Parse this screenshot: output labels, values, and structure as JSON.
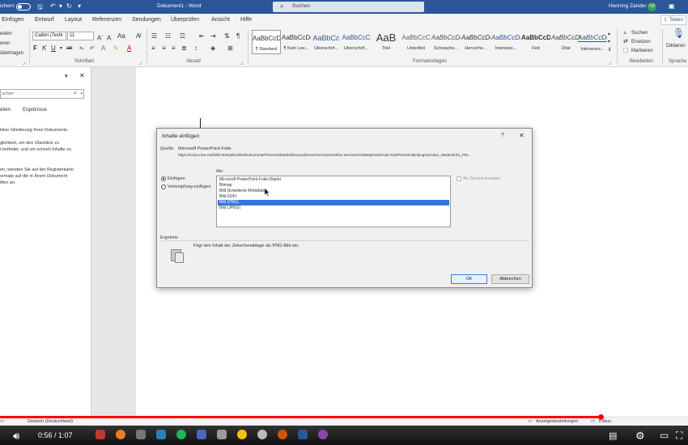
{
  "window": {
    "autosave_label": "ichern",
    "title": "Dokument1 - Word",
    "search_placeholder": "Suchen",
    "user": "Henning Zander",
    "avatar_initials": "HZ"
  },
  "menu": {
    "tabs": [
      "Einfügen",
      "Entwurf",
      "Layout",
      "Referenzen",
      "Sendungen",
      "Überprüfen",
      "Ansicht",
      "Hilfe"
    ],
    "share_label": "Teilen"
  },
  "ribbon": {
    "clipboard": {
      "partial1": "eiden",
      "partial2": "eren",
      "format_painter": "übertragen"
    },
    "font": {
      "family": "Calibri (Textk",
      "size": "11",
      "label": "Schriftart",
      "buttons": [
        "F",
        "K",
        "U",
        "ab",
        "x₂",
        "x²"
      ]
    },
    "paragraph": {
      "label": "Absatz"
    },
    "styles": {
      "label": "Formatvorlagen",
      "items": [
        {
          "preview": "AaBbCcDc",
          "name": "¶ Standard"
        },
        {
          "preview": "AaBbCcDc",
          "name": "¶ Kein Lee..."
        },
        {
          "preview": "AaBbCc",
          "name": "Überschrif..."
        },
        {
          "preview": "AaBbCcC",
          "name": "Überschrif..."
        },
        {
          "preview": "AaB",
          "name": "Titel"
        },
        {
          "preview": "AaBbCcC",
          "name": "Untertitel"
        },
        {
          "preview": "AaBbCcDc",
          "name": "Schwache..."
        },
        {
          "preview": "AaBbCcDc",
          "name": "Hervorhe..."
        },
        {
          "preview": "AaBbCcDc",
          "name": "Intensive..."
        },
        {
          "preview": "AaBbCcDc",
          "name": "Fett"
        },
        {
          "preview": "AaBbCcDc",
          "name": "Zitat"
        },
        {
          "preview": "AaBbCcDc",
          "name": "Intensives..."
        }
      ]
    },
    "editing": {
      "label": "Bearbeiten",
      "search": "Suchen",
      "replace": "Ersetzen",
      "select": "Markieren"
    },
    "voice": {
      "dictate": "Diktieren",
      "label": "Sprache"
    }
  },
  "navpane": {
    "search_placeholder": "uchen",
    "tab_headings": "eiten",
    "tab_results": "Ergebnisse",
    "lines": [
      "ktive Gliederung Ihres Dokuments.",
      "glichkeit, um den Überblick zu",
      "t befindet, und um schnell Inhalte zu",
      "en, wenden Sie auf der Registerkarte",
      "ormate auf die in Ihrem Dokument",
      "iften an."
    ]
  },
  "dialog": {
    "title": "Inhalte einfügen",
    "help": "?",
    "close": "✕",
    "source_label": "Quelle:",
    "source_value": "Microsoft PowerPoint-Folie",
    "source_path": "https://d.docs.live.net/b9fe733316bc4904/Dokumente/Pres%20Marbell/Journalismus/Seminare/Online Seminar%20Wadersloh%20-%20Pressemitteilung/Seminar_Wadersloh1_PM...",
    "as_label": "Als:",
    "radio_paste": "Einfügen",
    "radio_link": "Verknüpfung einfügen",
    "as_icon_label": "Als Symbol anzeigen",
    "formats": [
      "Microsoft PowerPoint-Folie-Objekt",
      "Bitmap",
      "Bild (Erweiterte Metadatei)",
      "Bild (GIF)",
      "Bild (PNG)",
      "Bild (JPEG)"
    ],
    "selected_index": 4,
    "result_label": "Ergebnis",
    "result_text": "Fügt den Inhalt der Zwischenablage als PNG-Bild ein.",
    "ok": "OK",
    "cancel": "Abbrechen"
  },
  "statusbar": {
    "language": "Deutsch (Deutschland)",
    "display_settings": "Anzeigeeinstellungen",
    "focus": "Fokus"
  },
  "video": {
    "time": "0:56 / 1:07",
    "progress": 0.873
  },
  "colors": {
    "word_blue": "#2b579a",
    "progress_red": "#ff0000",
    "selection_blue": "#3377dd"
  }
}
